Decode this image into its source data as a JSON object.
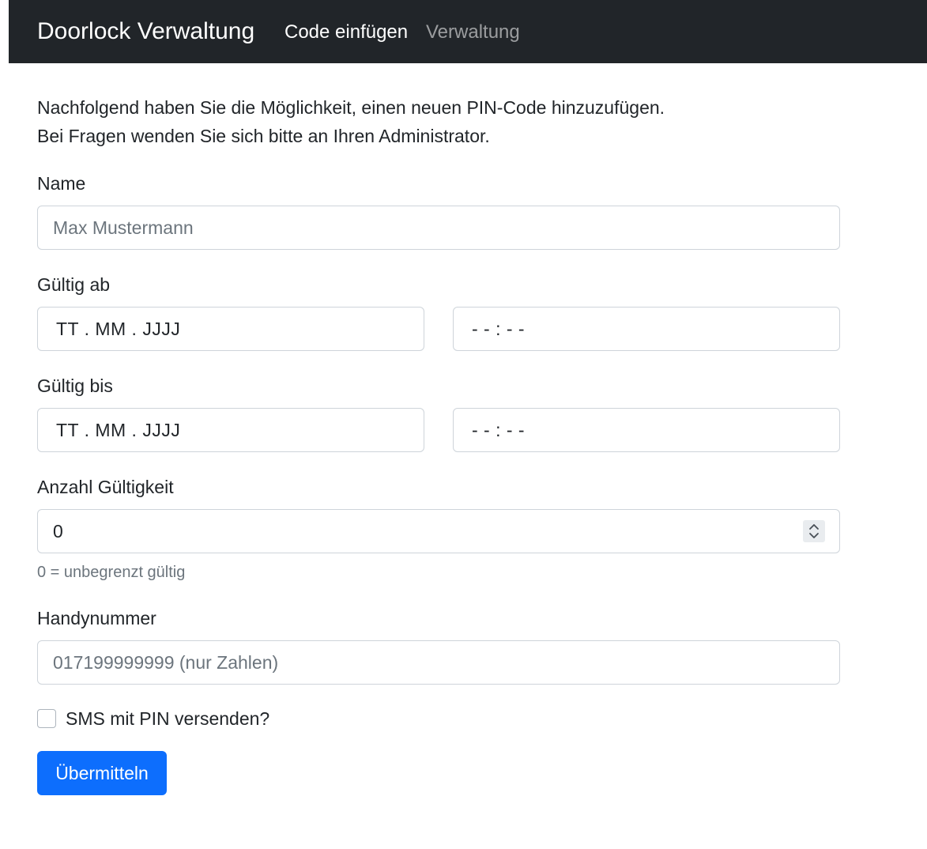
{
  "navbar": {
    "brand": "Doorlock Verwaltung",
    "links": [
      {
        "label": "Code einfügen",
        "active": true
      },
      {
        "label": "Verwaltung",
        "active": false
      }
    ]
  },
  "intro": {
    "line1": "Nachfolgend haben Sie die Möglichkeit, einen neuen PIN-Code hinzuzufügen.",
    "line2": "Bei Fragen wenden Sie sich bitte an Ihren Administrator."
  },
  "form": {
    "name": {
      "label": "Name",
      "placeholder": "Max Mustermann",
      "value": ""
    },
    "valid_from": {
      "label": "Gültig ab",
      "date_mask": "TT.MM.JJJJ",
      "time_mask": "--:--"
    },
    "valid_to": {
      "label": "Gültig bis",
      "date_mask": "TT.MM.JJJJ",
      "time_mask": "--:--"
    },
    "count": {
      "label": "Anzahl Gültigkeit",
      "value": "0",
      "help": "0 = unbegrenzt gültig"
    },
    "phone": {
      "label": "Handynummer",
      "placeholder": "017199999999 (nur Zahlen)",
      "value": ""
    },
    "sms": {
      "label": "SMS mit PIN versenden?",
      "checked": false
    },
    "submit_label": "Übermitteln"
  },
  "colors": {
    "navbar_bg": "#212529",
    "primary": "#0d6efd",
    "border": "#ced4da",
    "muted": "#6c757d"
  }
}
